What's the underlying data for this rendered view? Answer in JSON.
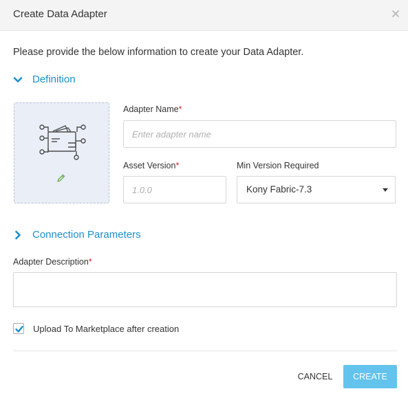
{
  "dialog": {
    "title": "Create Data Adapter",
    "close_icon": "close-icon",
    "intro": "Please provide the below information to create your Data Adapter."
  },
  "definition": {
    "label": "Definition",
    "expanded": true,
    "icon_box": {
      "adapter_icon": "data-adapter-icon",
      "edit_icon": "pencil-icon"
    },
    "adapter_name": {
      "label": "Adapter Name",
      "required_mark": "*",
      "value": "",
      "placeholder": "Enter adapter name"
    },
    "asset_version": {
      "label": "Asset Version",
      "required_mark": "*",
      "value": "",
      "placeholder": "1.0.0"
    },
    "min_version": {
      "label": "Min Version Required",
      "selected": "Kony Fabric-7.3"
    }
  },
  "connection": {
    "label": "Connection Parameters",
    "expanded": false
  },
  "description": {
    "label": "Adapter Description",
    "required_mark": "*",
    "value": ""
  },
  "upload": {
    "label": "Upload To Marketplace after creation",
    "checked": true
  },
  "buttons": {
    "cancel": "CANCEL",
    "create": "CREATE"
  },
  "colors": {
    "accent": "#1a8fc9",
    "create_button": "#63c3ec",
    "required": "#d9202d",
    "icon_box_bg": "#e9eef7",
    "pencil": "#6ab04c"
  }
}
